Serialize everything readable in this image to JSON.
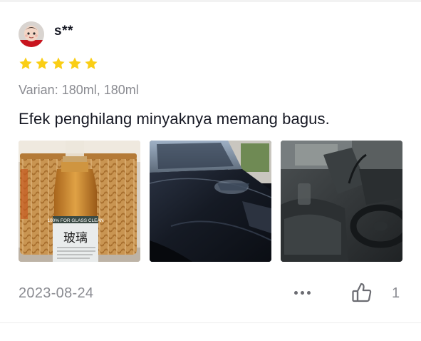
{
  "review": {
    "username": "s**",
    "rating": 5,
    "max_rating": 5,
    "variant": "Varian: 180ml, 180ml",
    "comment": "Efek penghilang minyaknya memang bagus.",
    "photos": [
      {
        "label_line1": "100% FOR GLASS CLEAN",
        "label_chinese": "玻璃"
      },
      {},
      {}
    ],
    "date": "2023-08-24",
    "like_count": "1"
  },
  "colors": {
    "star": "#FACE15",
    "muted_text": "#8a8b91",
    "primary_text": "#161823"
  },
  "icons": {
    "more": "more-horizontal-icon",
    "like": "thumbs-up-icon",
    "star": "star-icon"
  }
}
